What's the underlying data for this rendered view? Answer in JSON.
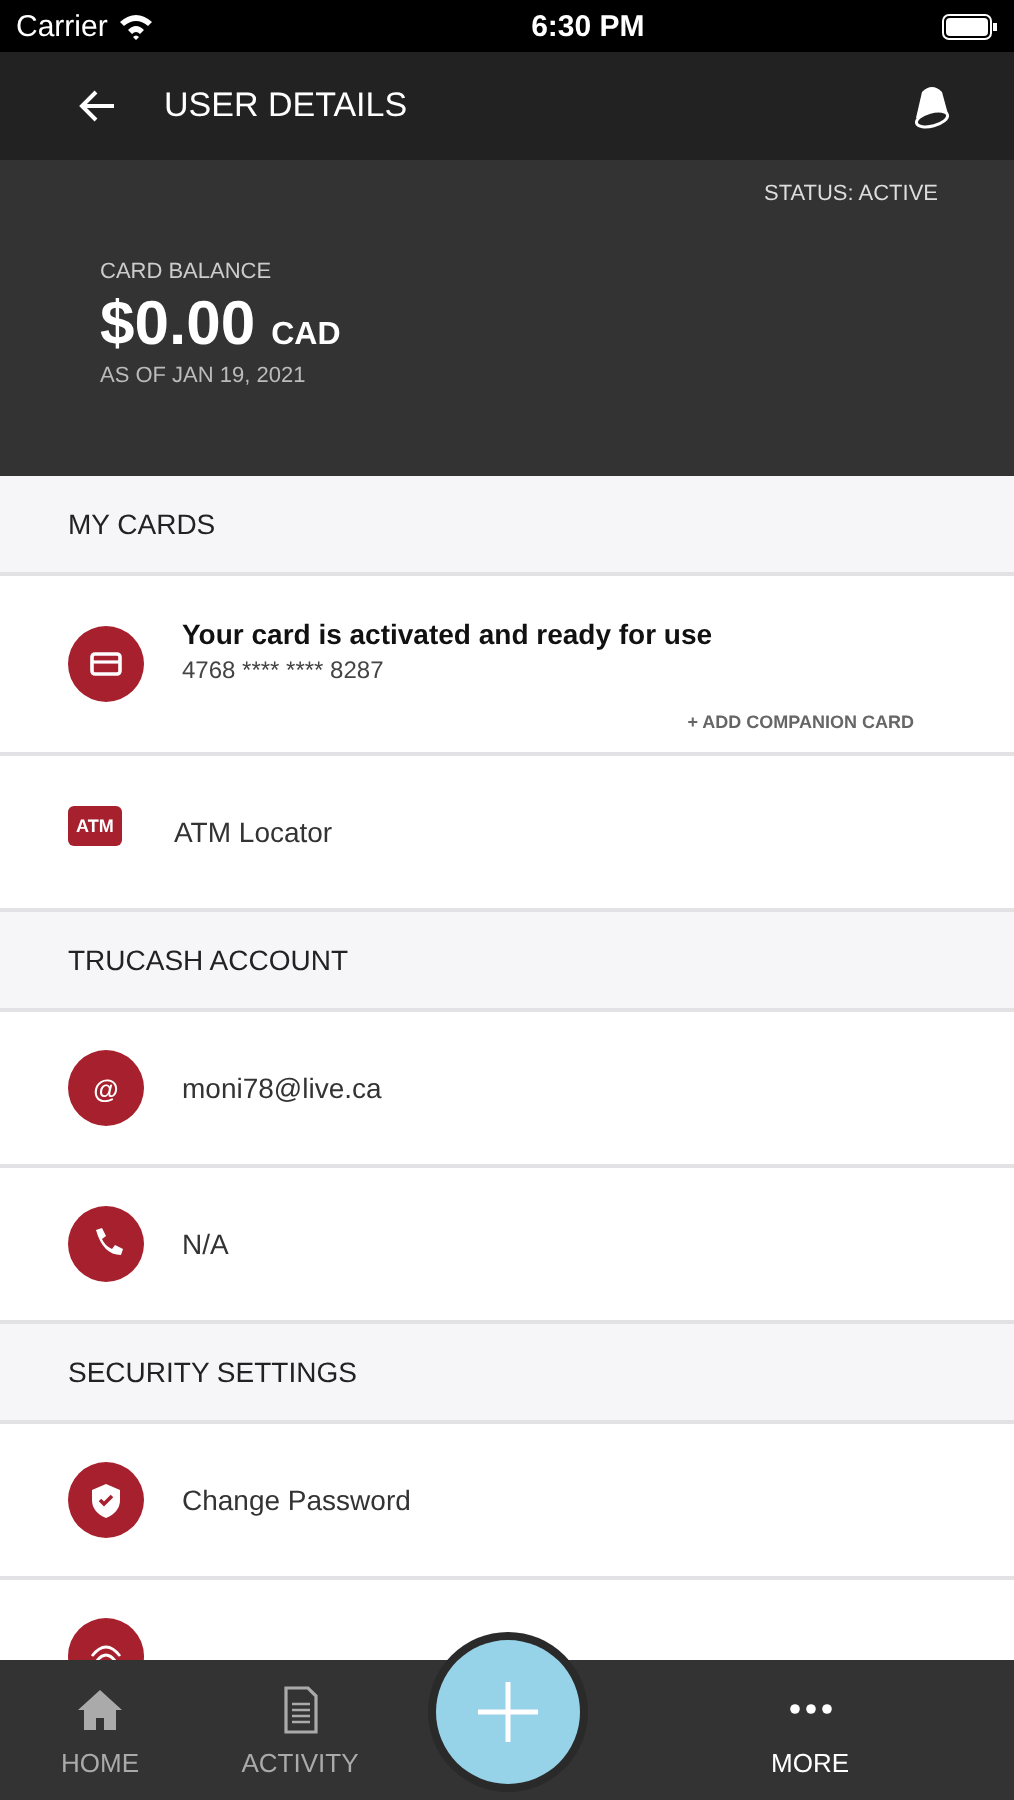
{
  "status_bar": {
    "carrier": "Carrier",
    "time": "6:30 PM"
  },
  "header": {
    "title": "USER DETAILS"
  },
  "balance": {
    "status": "STATUS: ACTIVE",
    "label": "CARD BALANCE",
    "amount": "$0.00",
    "currency": "CAD",
    "as_of": "AS OF JAN 19, 2021"
  },
  "sections": [
    {
      "title": "MY CARDS",
      "rows": [
        {
          "kind": "card",
          "title": "Your card is activated and ready for use",
          "subtitle": "4768 **** **** 8287",
          "action": "+ ADD COMPANION CARD"
        },
        {
          "kind": "atm",
          "label": "ATM Locator",
          "badge": "ATM"
        }
      ]
    },
    {
      "title": "TRUCASH ACCOUNT",
      "rows": [
        {
          "kind": "email",
          "label": "moni78@live.ca",
          "glyph": "@"
        },
        {
          "kind": "phone",
          "label": "N/A"
        }
      ]
    },
    {
      "title": "SECURITY SETTINGS",
      "rows": [
        {
          "kind": "shield",
          "label": "Change Password"
        },
        {
          "kind": "fingerprint"
        }
      ]
    }
  ],
  "tab_bar": {
    "items": [
      {
        "label": "HOME",
        "kind": "home",
        "selected": false
      },
      {
        "label": "ACTIVITY",
        "kind": "activity",
        "selected": false
      },
      {
        "kind": "add"
      },
      {
        "label": "MORE",
        "kind": "more",
        "selected": true
      }
    ]
  }
}
